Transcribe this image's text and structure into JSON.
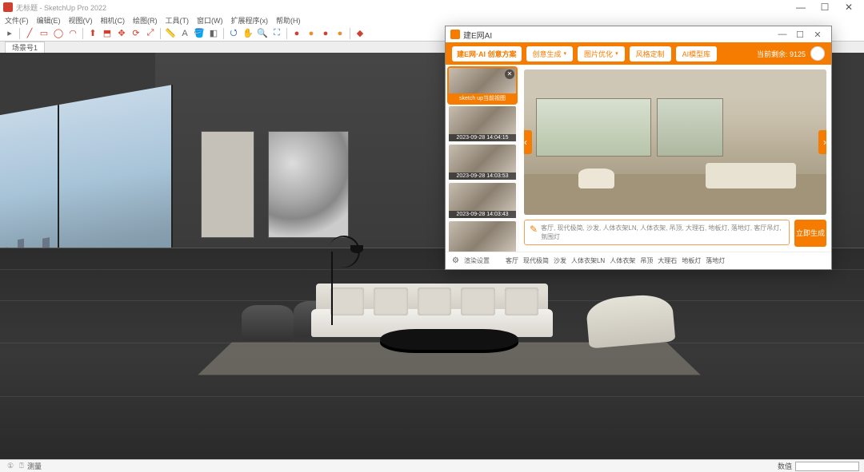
{
  "app": {
    "title": "无标题 - SketchUp Pro 2022",
    "window_buttons": {
      "min": "—",
      "max": "☐",
      "close": "✕"
    }
  },
  "menu": [
    "文件(F)",
    "编辑(E)",
    "视图(V)",
    "相机(C)",
    "绘图(R)",
    "工具(T)",
    "窗口(W)",
    "扩展程序(x)",
    "帮助(H)"
  ],
  "scene_tab": "场景号1",
  "statusbar": {
    "left_icon1": "①",
    "left_icon2": "⍰",
    "left_text": "测量",
    "right_text": "数值"
  },
  "ai": {
    "window_title": "建E网AI",
    "window_buttons": {
      "min": "—",
      "max": "☐",
      "close": "✕"
    },
    "logo": "建E网·AI 创意方案",
    "header_buttons": [
      {
        "label": "创意生成",
        "caret": "▾"
      },
      {
        "label": "图片优化",
        "caret": "▾"
      },
      {
        "label": "风格定制",
        "caret": ""
      },
      {
        "label": "AI模型库",
        "caret": ""
      }
    ],
    "credit": "当前剩余: 9125",
    "thumbs": [
      {
        "label": "sketch up当前视图",
        "active": true,
        "closable": true
      },
      {
        "label": "2023-09-28 14:04:15",
        "active": false,
        "closable": false
      },
      {
        "label": "2023-09-28 14:03:53",
        "active": false,
        "closable": false
      },
      {
        "label": "2023-09-28 14:03:43",
        "active": false,
        "closable": false
      },
      {
        "label": "",
        "active": false,
        "closable": false
      }
    ],
    "nav": {
      "left": "‹",
      "right": "›"
    },
    "prompt_text": "客厅, 现代极简, 沙发, 人体衣架LN, 人体衣架, 吊顶, 大理石, 地板灯, 落地灯, 客厅吊灯, 氛围灯",
    "prompt_icon": "✎",
    "generate": "立即生成",
    "footer": {
      "gear": "⚙",
      "settings_label": "渲染设置",
      "tags": [
        "客厅",
        "现代极简",
        "沙发",
        "人体衣架LN",
        "人体衣架",
        "吊顶",
        "大理石",
        "地板灯",
        "落地灯"
      ]
    }
  }
}
